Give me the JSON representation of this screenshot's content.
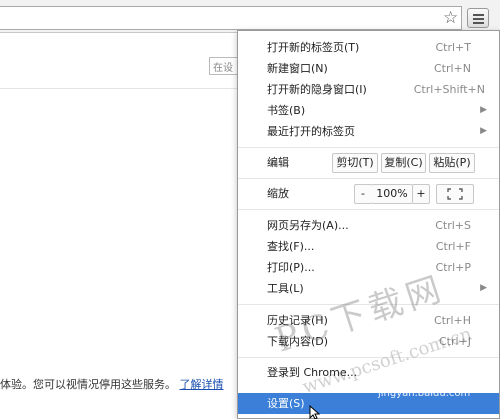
{
  "browser": {
    "bookmark_icon": "star-icon",
    "menu_icon": "hamburger-icon",
    "page_search_placeholder": "在设"
  },
  "page": {
    "text_before": "体验。您可以视情况停用这些服务。",
    "link": "了解详情"
  },
  "menu": {
    "items_top": [
      {
        "label": "打开新的标签页(T)",
        "shortcut": "Ctrl+T"
      },
      {
        "label": "新建窗口(N)",
        "shortcut": "Ctrl+N"
      },
      {
        "label": "打开新的隐身窗口(I)",
        "shortcut": "Ctrl+Shift+N"
      },
      {
        "label": "书签(B)",
        "shortcut": "",
        "arrow": "▶"
      },
      {
        "label": "最近打开的标签页",
        "shortcut": "",
        "arrow": "▶"
      }
    ],
    "edit": {
      "label": "编辑",
      "cut": "剪切(T)",
      "copy": "复制(C)",
      "paste": "粘贴(P)"
    },
    "zoom": {
      "label": "缩放",
      "minus": "-",
      "value": "100%",
      "plus": "+",
      "fullscreen_icon": "fullscreen-icon"
    },
    "items_mid": [
      {
        "label": "网页另存为(A)...",
        "shortcut": "Ctrl+S"
      },
      {
        "label": "查找(F)...",
        "shortcut": "Ctrl+F"
      },
      {
        "label": "打印(P)...",
        "shortcut": "Ctrl+P"
      },
      {
        "label": "工具(L)",
        "shortcut": "",
        "arrow": "▶"
      }
    ],
    "items_hist": [
      {
        "label": "历史记录(H)",
        "shortcut": "Ctrl+H"
      },
      {
        "label": "下载内容(D)",
        "shortcut": "Ctrl+J"
      }
    ],
    "signin": "登录到 Chrome...",
    "settings": "设置(S)",
    "selected_color": "#3b7fd9"
  },
  "watermarks": {
    "main": "PC下载网",
    "url": "www.pcsoft.com.cn",
    "baidu": "jingyan.baidu.com"
  }
}
